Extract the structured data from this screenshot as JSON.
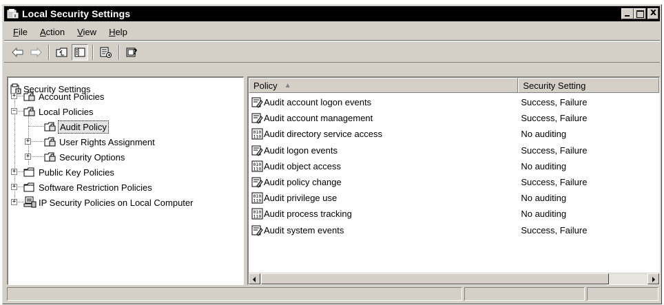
{
  "window": {
    "title": "Local Security Settings"
  },
  "menu": [
    {
      "pre": "",
      "u": "F",
      "post": "ile"
    },
    {
      "pre": "",
      "u": "A",
      "post": "ction"
    },
    {
      "pre": "",
      "u": "V",
      "post": "iew"
    },
    {
      "pre": "",
      "u": "H",
      "post": "elp"
    }
  ],
  "toolbar": {
    "back_icon": "back-arrow-icon",
    "forward_icon": "forward-arrow-icon",
    "up_icon": "up-one-level-icon",
    "show_hide_tree_icon": "show-hide-console-tree-icon",
    "export_icon": "export-list-icon",
    "help_icon": "help-icon"
  },
  "tree": {
    "root": "Security Settings",
    "items": [
      {
        "label": "Account Policies"
      },
      {
        "label": "Local Policies"
      },
      {
        "label": "Audit Policy"
      },
      {
        "label": "User Rights Assignment"
      },
      {
        "label": "Security Options"
      },
      {
        "label": "Public Key Policies"
      },
      {
        "label": "Software Restriction Policies"
      },
      {
        "label": "IP Security Policies on Local Computer"
      }
    ]
  },
  "list": {
    "columns": [
      "Policy",
      "Security Setting"
    ],
    "sort_indicator": "▲",
    "rows": [
      {
        "policy": "Audit account logon events",
        "setting": "Success, Failure",
        "icon": "policy-enabled-icon"
      },
      {
        "policy": "Audit account management",
        "setting": "Success, Failure",
        "icon": "policy-enabled-icon"
      },
      {
        "policy": "Audit directory service access",
        "setting": "No auditing",
        "icon": "policy-binary-icon"
      },
      {
        "policy": "Audit logon events",
        "setting": "Success, Failure",
        "icon": "policy-enabled-icon"
      },
      {
        "policy": "Audit object access",
        "setting": "No auditing",
        "icon": "policy-binary-icon"
      },
      {
        "policy": "Audit policy change",
        "setting": "Success, Failure",
        "icon": "policy-enabled-icon"
      },
      {
        "policy": "Audit privilege use",
        "setting": "No auditing",
        "icon": "policy-binary-icon"
      },
      {
        "policy": "Audit process tracking",
        "setting": "No auditing",
        "icon": "policy-binary-icon"
      },
      {
        "policy": "Audit system events",
        "setting": "Success, Failure",
        "icon": "policy-enabled-icon"
      }
    ]
  }
}
